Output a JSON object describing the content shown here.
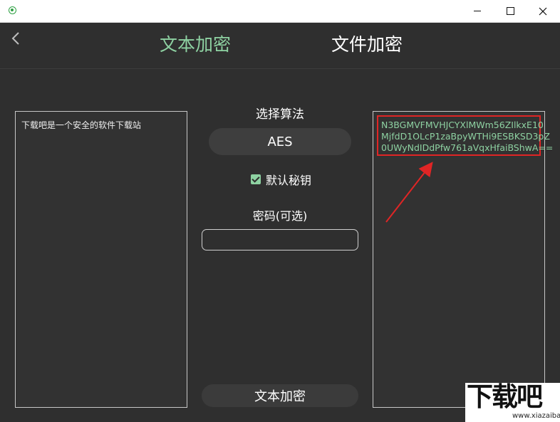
{
  "window": {
    "icon": "app-eye-icon",
    "controls": [
      "minimize-icon",
      "maximize-icon",
      "close-icon"
    ]
  },
  "header": {
    "back_icon": "chevron-left-icon",
    "tabs": [
      {
        "label": "文本加密",
        "active": true,
        "color": "#8ed2a2"
      },
      {
        "label": "文件加密",
        "active": false,
        "color": "#ffffff"
      }
    ]
  },
  "input_panel": {
    "text": "下载吧是一个安全的软件下载站"
  },
  "center": {
    "algo_label": "选择算法",
    "algo_value": "AES",
    "default_key_label": "默认秘钥",
    "default_key_checked": true,
    "password_label": "密码(可选)",
    "password_value": "",
    "encrypt_button": "文本加密"
  },
  "output_panel": {
    "lines": [
      "N3BGMVFMVHJCYXlMWm56ZIlkxE10",
      "MjfdD1OLcP1zaBpyWTHi9ESBKSD3pZ",
      "0UWyNdIDdPfw761aVqxHfaiBShwA=="
    ],
    "text_color": "#8ed2a2",
    "highlight_color": "#e02525"
  },
  "watermark": {
    "logo": "下载吧",
    "url": "www.xiazaiba.com"
  }
}
